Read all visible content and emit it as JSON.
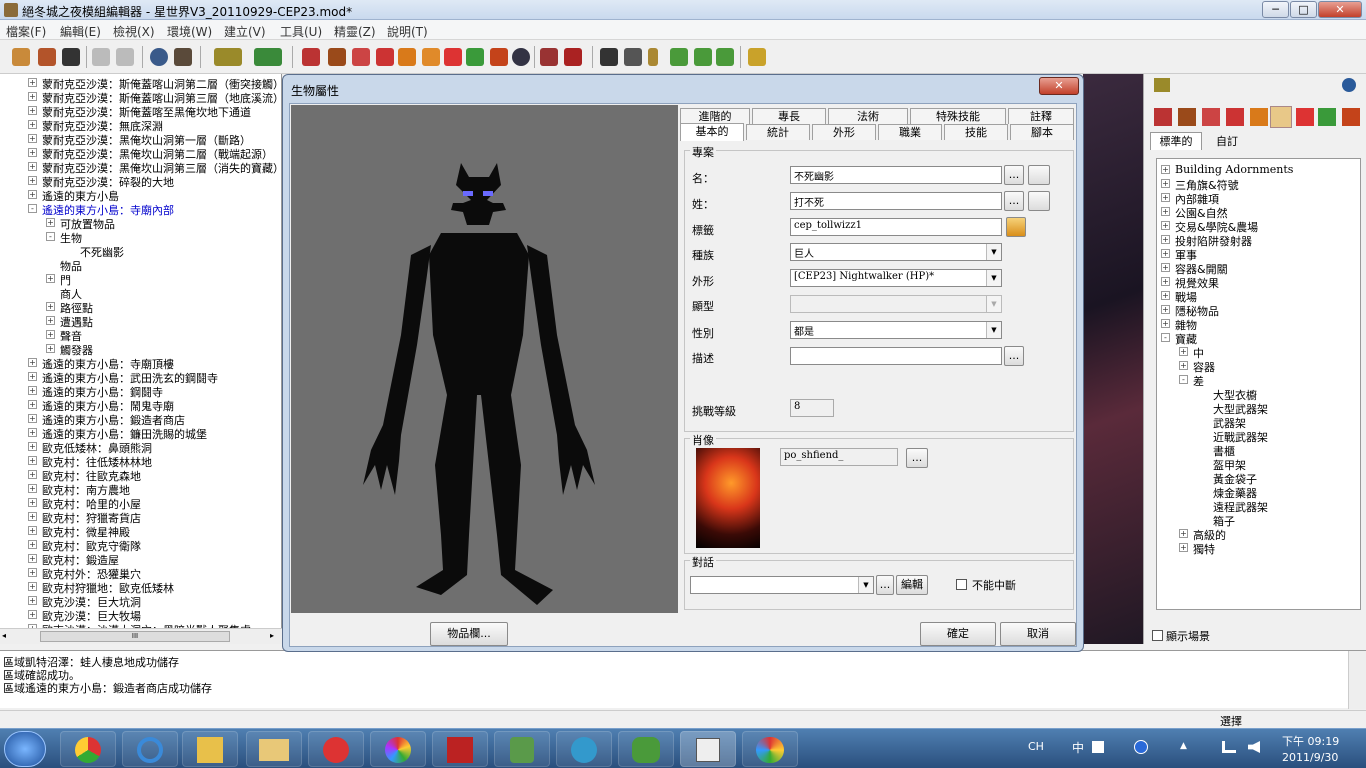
{
  "app": {
    "title": "絕冬城之夜模組編輯器 - 星世界V3_20110929-CEP23.mod*",
    "minimize": "─",
    "maximize": "□",
    "close": "✕"
  },
  "menu": [
    "檔案(F)",
    "編輯(E)",
    "檢視(X)",
    "環境(W)",
    "建立(V)",
    "工具(U)",
    "精靈(Z)",
    "說明(T)"
  ],
  "left_tree": [
    {
      "label": "蒙耐克亞沙漠：斯俺蓋喀山洞第二層（衝突接觸）",
      "level": 1,
      "exp": "+"
    },
    {
      "label": "蒙耐克亞沙漠：斯俺蓋喀山洞第三層（地底溪流）",
      "level": 1,
      "exp": "+"
    },
    {
      "label": "蒙耐克亞沙漠：斯俺蓋喀至黑俺坎地下通道",
      "level": 1,
      "exp": "+"
    },
    {
      "label": "蒙耐克亞沙漠：無底深淵",
      "level": 1,
      "exp": "+"
    },
    {
      "label": "蒙耐克亞沙漠：黑俺坎山洞第一層（斷路）",
      "level": 1,
      "exp": "+"
    },
    {
      "label": "蒙耐克亞沙漠：黑俺坎山洞第二層（戰端起源）",
      "level": 1,
      "exp": "+"
    },
    {
      "label": "蒙耐克亞沙漠：黑俺坎山洞第三層（消失的寶藏）",
      "level": 1,
      "exp": "+"
    },
    {
      "label": "蒙耐克亞沙漠：碎裂的大地",
      "level": 1,
      "exp": "+"
    },
    {
      "label": "遙遠的東方小島",
      "level": 1,
      "exp": "+"
    },
    {
      "label": "遙遠的東方小島：寺廟內部",
      "level": 1,
      "exp": "−",
      "selected": true
    },
    {
      "label": "可放置物品",
      "level": 2,
      "exp": "+"
    },
    {
      "label": "生物",
      "level": 2,
      "exp": "−"
    },
    {
      "label": "不死幽影",
      "level": 3,
      "exp": ""
    },
    {
      "label": "物品",
      "level": 2,
      "exp": ""
    },
    {
      "label": "門",
      "level": 2,
      "exp": "+"
    },
    {
      "label": "商人",
      "level": 2,
      "exp": ""
    },
    {
      "label": "路徑點",
      "level": 2,
      "exp": "+"
    },
    {
      "label": "遭遇點",
      "level": 2,
      "exp": "+"
    },
    {
      "label": "聲音",
      "level": 2,
      "exp": "+"
    },
    {
      "label": "觸發器",
      "level": 2,
      "exp": "+"
    },
    {
      "label": "遙遠的東方小島：寺廟頂樓",
      "level": 1,
      "exp": "+"
    },
    {
      "label": "遙遠的東方小島：武田洗玄的鋼鬪寺",
      "level": 1,
      "exp": "+"
    },
    {
      "label": "遙遠的東方小島：鋼鬪寺",
      "level": 1,
      "exp": "+"
    },
    {
      "label": "遙遠的東方小島：鬧鬼寺廟",
      "level": 1,
      "exp": "+"
    },
    {
      "label": "遙遠的東方小島：鍛造者商店",
      "level": 1,
      "exp": "+"
    },
    {
      "label": "遙遠的東方小島：鐮田洗賜的城堡",
      "level": 1,
      "exp": "+"
    },
    {
      "label": "歐克低矮林：鼻頭熊洞",
      "level": 1,
      "exp": "+"
    },
    {
      "label": "歐克村：往低矮林林地",
      "level": 1,
      "exp": "+"
    },
    {
      "label": "歐克村：往歐克森地",
      "level": 1,
      "exp": "+"
    },
    {
      "label": "歐克村：南方農地",
      "level": 1,
      "exp": "+"
    },
    {
      "label": "歐克村：哈里的小屋",
      "level": 1,
      "exp": "+"
    },
    {
      "label": "歐克村：狩獵寄貨店",
      "level": 1,
      "exp": "+"
    },
    {
      "label": "歐克村：微星神殿",
      "level": 1,
      "exp": "+"
    },
    {
      "label": "歐克村：歐克守衛隊",
      "level": 1,
      "exp": "+"
    },
    {
      "label": "歐克村：鍛造屋",
      "level": 1,
      "exp": "+"
    },
    {
      "label": "歐克村外：恐獾巢穴",
      "level": 1,
      "exp": "+"
    },
    {
      "label": "歐克村狩獵地：歐克低矮林",
      "level": 1,
      "exp": "+"
    },
    {
      "label": "歐克沙漠：巨大坑洞",
      "level": 1,
      "exp": "+"
    },
    {
      "label": "歐克沙漠：巨大牧場",
      "level": 1,
      "exp": "+"
    },
    {
      "label": "歐克沙漠：沙漠大洞穴：黑暗半獸人聚集處",
      "level": 1,
      "exp": "+"
    }
  ],
  "hscroll_grip": "III",
  "dialog": {
    "title": "生物屬性",
    "close": "✕",
    "tabs_back": [
      "進階的",
      "專長",
      "法術",
      "特殊技能",
      "註釋"
    ],
    "tabs_front": [
      "基本的",
      "統計",
      "外形",
      "職業",
      "技能",
      "腳本"
    ],
    "profile": {
      "group": "專案",
      "name_label": "名：",
      "name": "不死幽影",
      "surname_label": "姓：",
      "surname": "打不死",
      "tag_label": "標籤",
      "tag": "cep_tollwizz1",
      "race_label": "種族",
      "race": "巨人",
      "appearance_label": "外形",
      "appearance": "[CEP23] Nightwalker (HP)*",
      "body_label": "顯型",
      "body": "",
      "gender_label": "性別",
      "gender": "都是",
      "desc_label": "描述",
      "desc": "",
      "cr_label": "挑戰等級",
      "cr": "8",
      "more": "..."
    },
    "portrait": {
      "group": "肖像",
      "name": "po_shfiend_",
      "more": "..."
    },
    "dialogue": {
      "group": "對話",
      "value": "",
      "more": "...",
      "edit": "編輯",
      "no_interrupt": "不能中斷"
    },
    "inventory": "物品欄...",
    "ok": "確定",
    "cancel": "取消"
  },
  "palette": {
    "tabs": [
      "標準的",
      "自訂"
    ],
    "tree": [
      {
        "label": "Building Adornments",
        "level": 0,
        "exp": "+"
      },
      {
        "label": "三角旗&符號",
        "level": 0,
        "exp": "+"
      },
      {
        "label": "內部雜項",
        "level": 0,
        "exp": "+"
      },
      {
        "label": "公園&自然",
        "level": 0,
        "exp": "+"
      },
      {
        "label": "交易&學院&農場",
        "level": 0,
        "exp": "+"
      },
      {
        "label": "投射陷阱發射器",
        "level": 0,
        "exp": "+"
      },
      {
        "label": "軍事",
        "level": 0,
        "exp": "+"
      },
      {
        "label": "容器&開關",
        "level": 0,
        "exp": "+"
      },
      {
        "label": "視覺效果",
        "level": 0,
        "exp": "+"
      },
      {
        "label": "戰場",
        "level": 0,
        "exp": "+"
      },
      {
        "label": "隱秘物品",
        "level": 0,
        "exp": "+"
      },
      {
        "label": "雜物",
        "level": 0,
        "exp": "+"
      },
      {
        "label": "寶藏",
        "level": 0,
        "exp": "−"
      },
      {
        "label": "中",
        "level": 1,
        "exp": "+"
      },
      {
        "label": "容器",
        "level": 1,
        "exp": "+"
      },
      {
        "label": "差",
        "level": 1,
        "exp": "−"
      },
      {
        "label": "大型衣櫥",
        "level": 2,
        "exp": ""
      },
      {
        "label": "大型武器架",
        "level": 2,
        "exp": ""
      },
      {
        "label": "武器架",
        "level": 2,
        "exp": ""
      },
      {
        "label": "近戰武器架",
        "level": 2,
        "exp": ""
      },
      {
        "label": "書櫃",
        "level": 2,
        "exp": ""
      },
      {
        "label": "盔甲架",
        "level": 2,
        "exp": ""
      },
      {
        "label": "黃金袋子",
        "level": 2,
        "exp": ""
      },
      {
        "label": "煉金藥器",
        "level": 2,
        "exp": ""
      },
      {
        "label": "遠程武器架",
        "level": 2,
        "exp": ""
      },
      {
        "label": "箱子",
        "level": 2,
        "exp": ""
      },
      {
        "label": "高級的",
        "level": 1,
        "exp": "+"
      },
      {
        "label": "獨特",
        "level": 1,
        "exp": "+"
      }
    ],
    "show_scene": "顯示場景"
  },
  "log": [
    "區域凱特沼澤：蛙人棲息地成功儲存",
    "區域確認成功。",
    "區域遙遠的東方小島：鍛造者商店成功儲存"
  ],
  "status": "選擇",
  "tray": {
    "ime": "CH",
    "ime2": "中",
    "time": "下午 09:19",
    "date": "2011/9/30"
  },
  "colors": {
    "selected": "#0000cc",
    "titlebar": "#dfe9f5",
    "preview": "#6f6f6f"
  }
}
